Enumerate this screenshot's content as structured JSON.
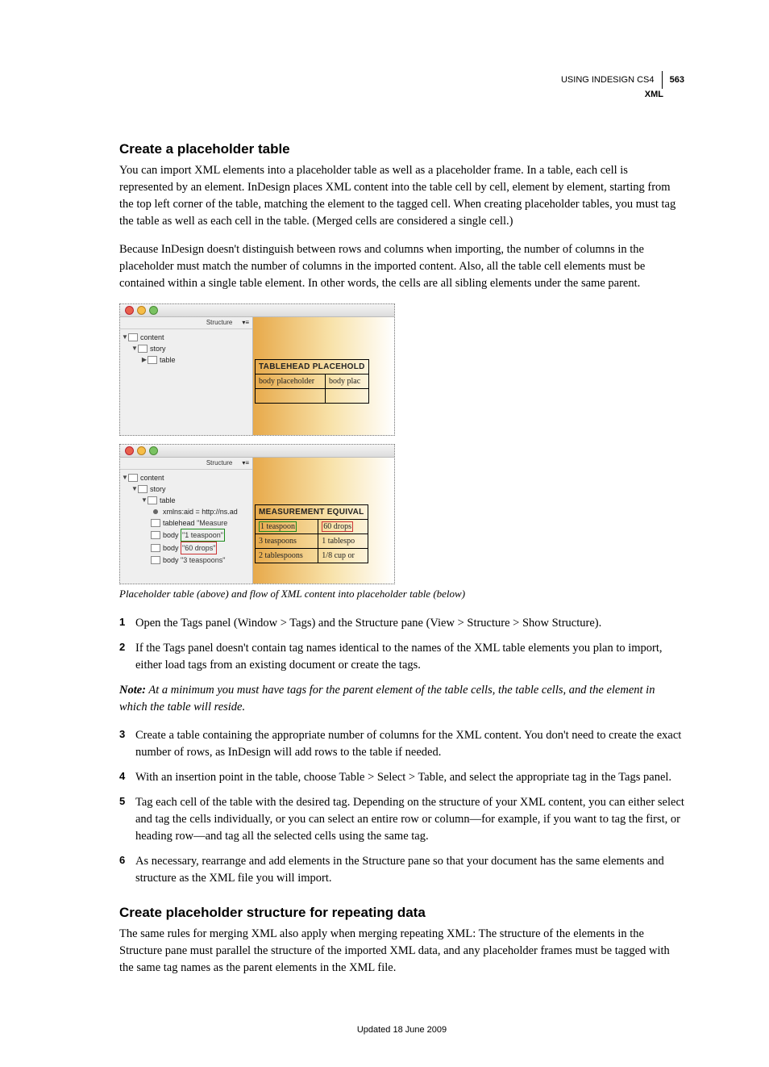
{
  "header": {
    "book_title": "USING INDESIGN CS4",
    "section": "XML",
    "page_number": "563"
  },
  "h2_a": "Create a placeholder table",
  "p1": "You can import XML elements into a placeholder table as well as a placeholder frame. In a table, each cell is represented by an element. InDesign places XML content into the table cell by cell, element by element, starting from the top left corner of the table, matching the element to the tagged cell. When creating placeholder tables, you must tag the table as well as each cell in the table. (Merged cells are considered a single cell.)",
  "p2": "Because InDesign doesn't distinguish between rows and columns when importing, the number of columns in the placeholder must match the number of columns in the imported content. Also, all the table cell elements must be contained within a single table element. In other words, the cells are all sibling elements under the same parent.",
  "figure": {
    "caption": "Placeholder table (above) and flow of XML content into placeholder table (below)",
    "structure_label": "Structure",
    "menu_glyph": "▾≡",
    "shot1": {
      "tree": {
        "content": "content",
        "story": "story",
        "table": "table"
      },
      "table_header": "TABLEHEAD PLACEHOLD",
      "r1c1": "body placeholder",
      "r1c2": "body plac"
    },
    "shot2": {
      "tree": {
        "content": "content",
        "story": "story",
        "table": "table",
        "attr": "xmlns:aid = http://ns.ad",
        "tablehead_label": "tablehead",
        "tablehead_val": "\"Measure",
        "body_label": "body",
        "body1_val": "\"1 teaspoon\"",
        "body2_val": "\"60 drops\"",
        "body3_val": "\"3 teaspoons\""
      },
      "table_header": "MEASUREMENT EQUIVAL",
      "rows": [
        [
          "1 teaspoon",
          "60 drops"
        ],
        [
          "3 teaspoons",
          "1 tablespo"
        ],
        [
          "2 tablespoons",
          "1/8 cup or"
        ]
      ]
    }
  },
  "steps": [
    "Open the Tags panel (Window > Tags) and the Structure pane (View > Structure > Show Structure).",
    "If the Tags panel doesn't contain tag names identical to the names of the XML table elements you plan to import, either load tags from an existing document or create the tags."
  ],
  "note": {
    "label": "Note:",
    "body": " At a minimum you must have tags for the parent element of the table cells, the table cells, and the element in which the table will reside."
  },
  "steps_b": [
    "Create a table containing the appropriate number of columns for the XML content. You don't need to create the exact number of rows, as InDesign will add rows to the table if needed.",
    "With an insertion point in the table, choose Table > Select > Table, and select the appropriate tag in the Tags panel.",
    "Tag each cell of the table with the desired tag. Depending on the structure of your XML content, you can either select and tag the cells individually, or you can select an entire row or column—for example, if you want to tag the first, or heading row—and tag all the selected cells using the same tag.",
    "As necessary, rearrange and add elements in the Structure pane so that your document has the same elements and structure as the XML file you will import."
  ],
  "h2_b": "Create placeholder structure for repeating data",
  "p3": "The same rules for merging XML also apply when merging repeating XML: The structure of the elements in the Structure pane must parallel the structure of the imported XML data, and any placeholder frames must be tagged with the same tag names as the parent elements in the XML file.",
  "footer": "Updated 18 June 2009"
}
